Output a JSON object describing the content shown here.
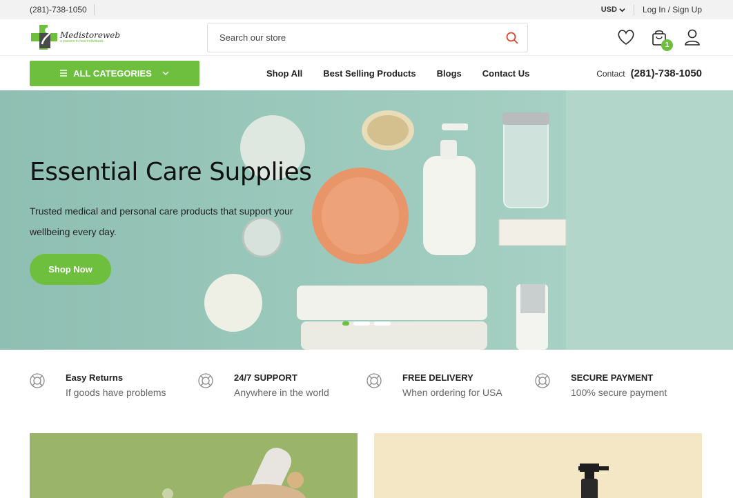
{
  "topbar": {
    "phone": "(281)-738-1050",
    "currency": "USD",
    "auth": "Log In / Sign Up"
  },
  "header": {
    "logo_name": "Medistoreweb",
    "logo_tagline": "a passion to heal individuals",
    "search_placeholder": "Search our store",
    "cart_count": "1"
  },
  "nav": {
    "categories_label": "ALL CATEGORIES",
    "menu": [
      "Shop All",
      "Best Selling Products",
      "Blogs",
      "Contact Us"
    ],
    "contact_label": "Contact",
    "contact_phone": "(281)-738-1050"
  },
  "hero": {
    "title": "Essential Care Supplies",
    "subtitle": "Trusted medical and personal care products that support your wellbeing every day.",
    "cta": "Shop Now"
  },
  "features": [
    {
      "title": "Easy Returns",
      "subtitle": "If goods have problems",
      "icon": "lifebuoy-icon"
    },
    {
      "title": "24/7 SUPPORT",
      "subtitle": "Anywhere in the world",
      "icon": "lifebuoy-icon"
    },
    {
      "title": "FREE DELIVERY",
      "subtitle": "When ordering for USA",
      "icon": "lifebuoy-icon"
    },
    {
      "title": "SECURE PAYMENT",
      "subtitle": "100% secure payment",
      "icon": "lifebuoy-icon"
    }
  ],
  "colors": {
    "accent": "#6fbf3f",
    "search_icon": "#e0452b"
  }
}
